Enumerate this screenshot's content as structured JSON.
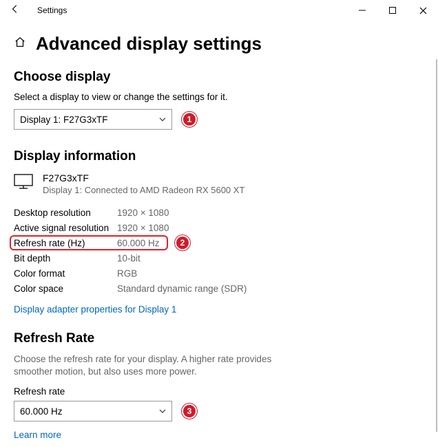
{
  "titlebar": {
    "app": "Settings"
  },
  "header": {
    "title": "Advanced display settings"
  },
  "choose_display": {
    "heading": "Choose display",
    "description": "Select a display to view or change the settings for it.",
    "selected": "Display 1: F27G3xTF"
  },
  "display_info": {
    "heading": "Display information",
    "name": "F27G3xTF",
    "sub": "Display 1: Connected to AMD Radeon RX 5600 XT",
    "rows": {
      "desktop_resolution": {
        "label": "Desktop resolution",
        "value": "1920 × 1080"
      },
      "active_signal_resolution": {
        "label": "Active signal resolution",
        "value": "1920 × 1080"
      },
      "refresh_rate_hz": {
        "label": "Refresh rate (Hz)",
        "value": "60.000 Hz"
      },
      "bit_depth": {
        "label": "Bit depth",
        "value": "10-bit"
      },
      "color_format": {
        "label": "Color format",
        "value": "RGB"
      },
      "color_space": {
        "label": "Color space",
        "value": "Standard dynamic range (SDR)"
      }
    },
    "adapter_link": "Display adapter properties for Display 1"
  },
  "refresh_rate": {
    "heading": "Refresh Rate",
    "description": "Choose the refresh rate for your display. A higher rate provides smoother motion, but also uses more power.",
    "field_label": "Refresh rate",
    "selected": "60.000 Hz",
    "learn_more": "Learn more"
  },
  "annotations": {
    "a1": "1",
    "a2": "2",
    "a3": "3"
  }
}
